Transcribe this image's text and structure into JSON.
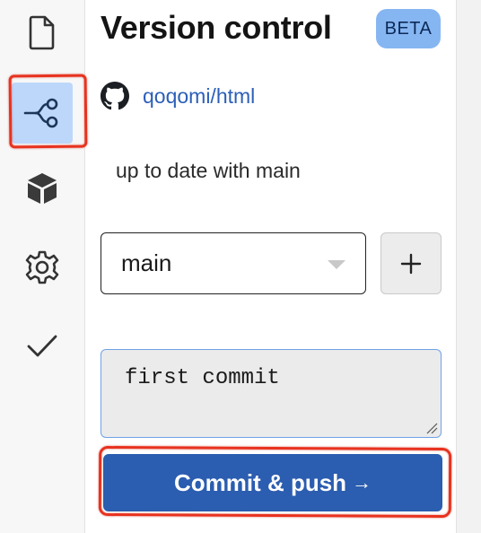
{
  "rail": {
    "items": [
      {
        "icon": "file-icon",
        "active": false
      },
      {
        "icon": "branch-icon",
        "active": true
      },
      {
        "icon": "cube-icon",
        "active": false
      },
      {
        "icon": "gear-icon",
        "active": false
      },
      {
        "icon": "check-icon",
        "active": false
      }
    ]
  },
  "header": {
    "title": "Version control",
    "badge": "BETA"
  },
  "repo": {
    "icon": "github-icon",
    "name": "qoqomi/html"
  },
  "status": "up to date with main",
  "branch": {
    "selected": "main",
    "add_label": "+"
  },
  "commit": {
    "message": "first commit",
    "button_label": "Commit & push",
    "button_arrow": "→"
  },
  "colors": {
    "accent": "#2b5db0",
    "active_rail": "#bcd7fa",
    "badge": "#86b6f2",
    "link": "#2c5fb8",
    "annotation": "#e8321f"
  }
}
